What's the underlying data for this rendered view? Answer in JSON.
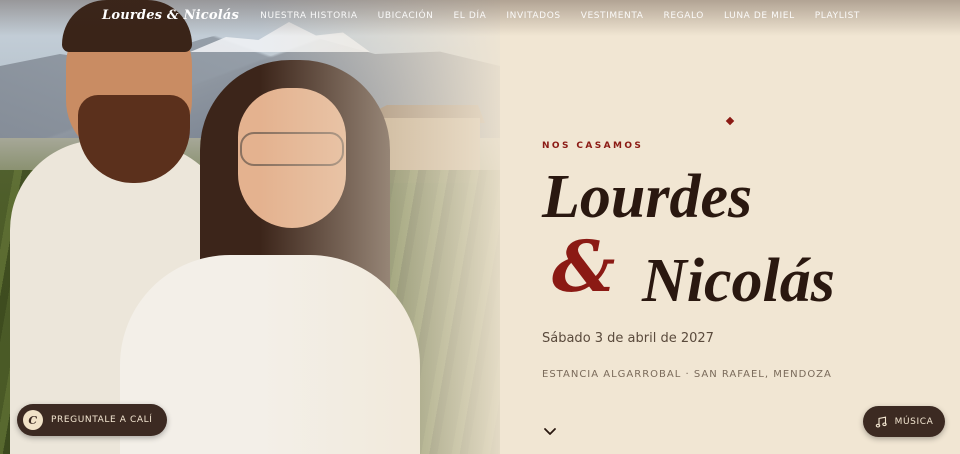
{
  "brand": {
    "name": "Lourdes & Nicolás"
  },
  "nav": {
    "items": [
      {
        "label": "NUESTRA HISTORIA"
      },
      {
        "label": "UBICACIÓN"
      },
      {
        "label": "EL DÍA"
      },
      {
        "label": "INVITADOS"
      },
      {
        "label": "VESTIMENTA"
      },
      {
        "label": "REGALO"
      },
      {
        "label": "LUNA DE MIEL"
      },
      {
        "label": "PLAYLIST"
      }
    ]
  },
  "hero": {
    "eyebrow": "NOS CASAMOS",
    "name_1": "Lourdes",
    "ampersand": "&",
    "name_2": "Nicolás",
    "date": "Sábado 3 de abril de 2027",
    "venue": "ESTANCIA ALGARROBAL · SAN RAFAEL, MENDOZA",
    "scroll_icon": "chevron-down-icon"
  },
  "assistant": {
    "avatar_letter": "C",
    "label": "PREGUNTALE A CALÍ"
  },
  "music": {
    "icon": "music-note-icon",
    "label": "MÚSICA"
  },
  "colors": {
    "accent": "#8b1a14",
    "background": "#f1e6d3",
    "button": "#3c2a22",
    "text": "#2a1810"
  }
}
